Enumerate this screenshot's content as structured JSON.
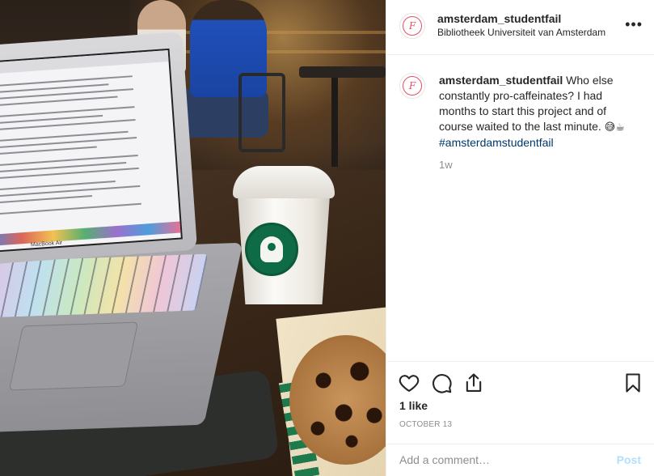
{
  "post": {
    "username": "amsterdam_studentfail",
    "location": "Bibliotheek Universiteit van Amsterdam",
    "more_icon": "more-horizontal-icon",
    "caption": {
      "username": "amsterdam_studentfail",
      "text": "Who else constantly pro-caffeinates? I had months to start this project and of course waited to the last minute.",
      "emoji": "😅☕",
      "hashtag": "#amsterdamstudentfail"
    },
    "age": "1w",
    "likes": "1 like",
    "date": "OCTOBER 13",
    "comment": {
      "placeholder": "Add a comment…",
      "post_label": "Post"
    },
    "actions": {
      "like": "heart-icon",
      "comment": "comment-icon",
      "share": "share-icon",
      "save": "bookmark-icon"
    },
    "photo": {
      "laptop_brand": "MacBook Air"
    }
  },
  "colors": {
    "text": "#262626",
    "muted": "#8e8e8e",
    "hashtag": "#00376b",
    "post_disabled": "#b2dffc",
    "avatar_accent": "#e44f64",
    "divider": "#efefef"
  }
}
